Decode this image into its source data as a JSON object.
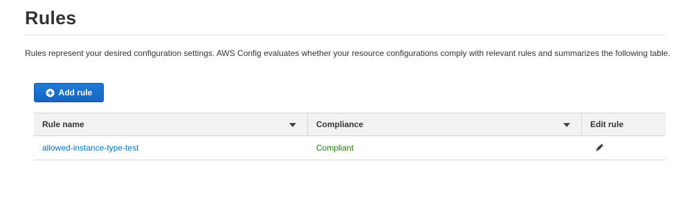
{
  "header": {
    "title": "Rules"
  },
  "description": "Rules represent your desired configuration settings. AWS Config evaluates whether your resource configurations comply with relevant rules and summarizes the following table.",
  "toolbar": {
    "add_rule_label": "Add rule",
    "add_icon": "plus-circle-icon"
  },
  "table": {
    "columns": [
      {
        "label": "Rule name",
        "sortable": true
      },
      {
        "label": "Compliance",
        "sortable": true
      },
      {
        "label": "Edit rule",
        "sortable": false
      }
    ],
    "rows": [
      {
        "rule_name": "allowed-instance-type-test",
        "compliance": "Compliant",
        "edit_icon": "pencil-icon"
      }
    ]
  },
  "colors": {
    "primary_button": "#1a70cb",
    "link": "#0073bb",
    "compliant": "#1d8102",
    "header_bg": "#f2f2f2"
  }
}
